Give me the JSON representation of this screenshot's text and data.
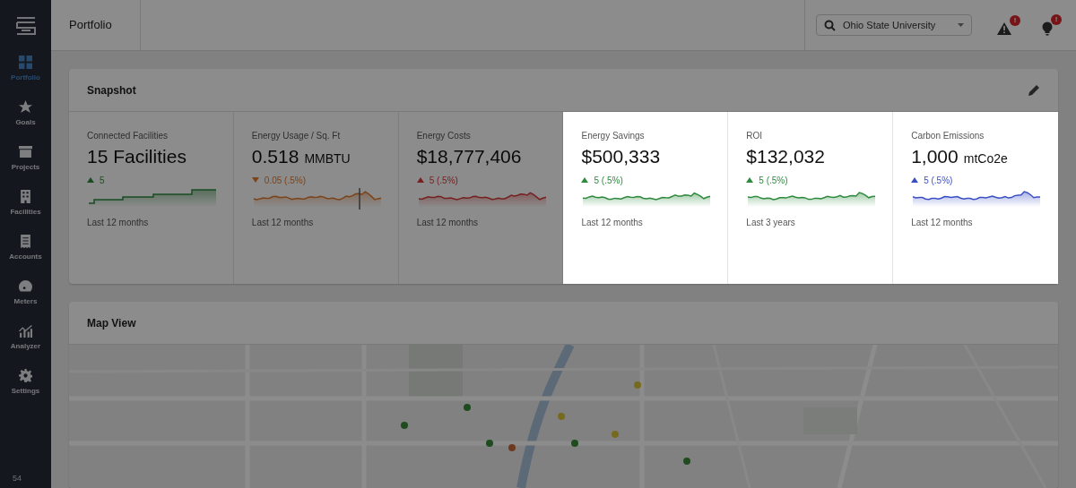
{
  "sidebar": {
    "items": [
      {
        "label": "Portfolio",
        "kind": "grid",
        "selected": true
      },
      {
        "label": "Goals",
        "kind": "star",
        "selected": false
      },
      {
        "label": "Projects",
        "kind": "box",
        "selected": false
      },
      {
        "label": "Facilities",
        "kind": "building",
        "selected": false
      },
      {
        "label": "Accounts",
        "kind": "receipt",
        "selected": false
      },
      {
        "label": "Meters",
        "kind": "gauge",
        "selected": false
      },
      {
        "label": "Analyzer",
        "kind": "chart",
        "selected": false
      },
      {
        "label": "Settings",
        "kind": "gear",
        "selected": false
      }
    ],
    "footer": "54"
  },
  "header": {
    "title": "Portfolio",
    "search": {
      "value": "Ohio State University"
    },
    "alerts": [
      {
        "kind": "warning",
        "badge": "!"
      },
      {
        "kind": "bulb",
        "badge": "!"
      }
    ]
  },
  "snapshot": {
    "title": "Snapshot",
    "metrics": [
      {
        "label": "Connected Facilities",
        "value": "15 Facilities",
        "rising": true,
        "change": "5",
        "color": "#194c22",
        "kind": "step",
        "period": "Last 12 months",
        "highlighted": false
      },
      {
        "label": "Energy Usage / Sq. Ft",
        "value": "0.518",
        "unit": "MMBTU",
        "rising": false,
        "change": "0.05 (.5%)",
        "color": "#7b431a",
        "kind": "wave-marker",
        "period": "Last 12 months",
        "highlighted": false
      },
      {
        "label": "Energy Costs",
        "value": "$18,777,406",
        "rising": true,
        "change": "5 (.5%)",
        "color": "#762020",
        "kind": "wave",
        "period": "Last 12 months",
        "highlighted": false
      },
      {
        "label": "Energy Savings",
        "value": "$500,333",
        "rising": true,
        "change": "5 (.5%)",
        "color": "#2e8b3e",
        "kind": "wave",
        "period": "Last 12 months",
        "highlighted": true
      },
      {
        "label": "ROI",
        "value": "$132,032",
        "rising": true,
        "change": "5 (.5%)",
        "color": "#2e8b3e",
        "kind": "wave",
        "period": "Last 3 years",
        "highlighted": true
      },
      {
        "label": "Carbon Emissions",
        "value": "1,000",
        "unit": "mtCo2e",
        "rising": true,
        "change": "5 (.5%)",
        "color": "#3a4fc4",
        "kind": "wave",
        "period": "Last 12 months",
        "highlighted": true
      }
    ]
  },
  "map": {
    "title": "Map View",
    "kind": "picture"
  }
}
